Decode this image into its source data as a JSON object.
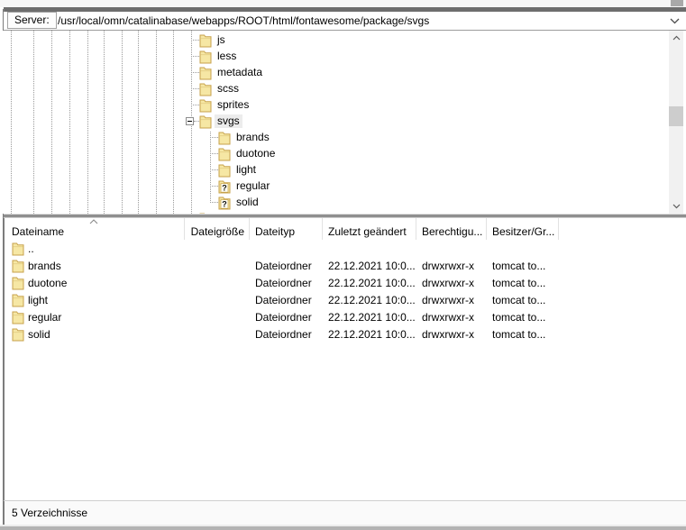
{
  "toolbar": {
    "server_label": "Server:",
    "path_value": "/usr/local/omn/catalinabase/webapps/ROOT/html/fontawesome/package/svgs"
  },
  "tree": {
    "items": [
      {
        "label": "js",
        "level": 0,
        "icon": "folder",
        "expander": "none",
        "selected": false
      },
      {
        "label": "less",
        "level": 0,
        "icon": "folder",
        "expander": "none",
        "selected": false
      },
      {
        "label": "metadata",
        "level": 0,
        "icon": "folder",
        "expander": "none",
        "selected": false
      },
      {
        "label": "scss",
        "level": 0,
        "icon": "folder",
        "expander": "none",
        "selected": false
      },
      {
        "label": "sprites",
        "level": 0,
        "icon": "folder",
        "expander": "none",
        "selected": false
      },
      {
        "label": "svgs",
        "level": 0,
        "icon": "folder",
        "expander": "minus",
        "selected": true
      },
      {
        "label": "brands",
        "level": 1,
        "icon": "folder",
        "expander": "none",
        "selected": false
      },
      {
        "label": "duotone",
        "level": 1,
        "icon": "folder",
        "expander": "none",
        "selected": false
      },
      {
        "label": "light",
        "level": 1,
        "icon": "folder",
        "expander": "none",
        "selected": false
      },
      {
        "label": "regular",
        "level": 1,
        "icon": "folder-question",
        "expander": "none",
        "selected": false
      },
      {
        "label": "solid",
        "level": 1,
        "icon": "folder-question",
        "expander": "none",
        "selected": false
      },
      {
        "label": "",
        "level": 0,
        "icon": "folder",
        "expander": "none",
        "selected": false
      }
    ]
  },
  "file_panel": {
    "columns": [
      {
        "label": "Dateiname",
        "sort": "asc"
      },
      {
        "label": "Dateigröße"
      },
      {
        "label": "Dateityp"
      },
      {
        "label": "Zuletzt geändert"
      },
      {
        "label": "Berechtigu..."
      },
      {
        "label": "Besitzer/Gr..."
      }
    ],
    "rows": [
      {
        "name": "..",
        "size": "",
        "type": "",
        "modified": "",
        "permissions": "",
        "owner": ""
      },
      {
        "name": "brands",
        "size": "",
        "type": "Dateiordner",
        "modified": "22.12.2021 10:0...",
        "permissions": "drwxrwxr-x",
        "owner": "tomcat to..."
      },
      {
        "name": "duotone",
        "size": "",
        "type": "Dateiordner",
        "modified": "22.12.2021 10:0...",
        "permissions": "drwxrwxr-x",
        "owner": "tomcat to..."
      },
      {
        "name": "light",
        "size": "",
        "type": "Dateiordner",
        "modified": "22.12.2021 10:0...",
        "permissions": "drwxrwxr-x",
        "owner": "tomcat to..."
      },
      {
        "name": "regular",
        "size": "",
        "type": "Dateiordner",
        "modified": "22.12.2021 10:0...",
        "permissions": "drwxrwxr-x",
        "owner": "tomcat to..."
      },
      {
        "name": "solid",
        "size": "",
        "type": "Dateiordner",
        "modified": "22.12.2021 10:0...",
        "permissions": "drwxrwxr-x",
        "owner": "tomcat to..."
      }
    ]
  },
  "status_bar": {
    "text": "5 Verzeichnisse"
  },
  "colors": {
    "folder_fill": "#f6e7a4",
    "folder_stroke": "#c7a24b",
    "dark_bar": "#6e6e6e",
    "selection_bg": "#ececec",
    "guide": "#9a9a9a"
  }
}
